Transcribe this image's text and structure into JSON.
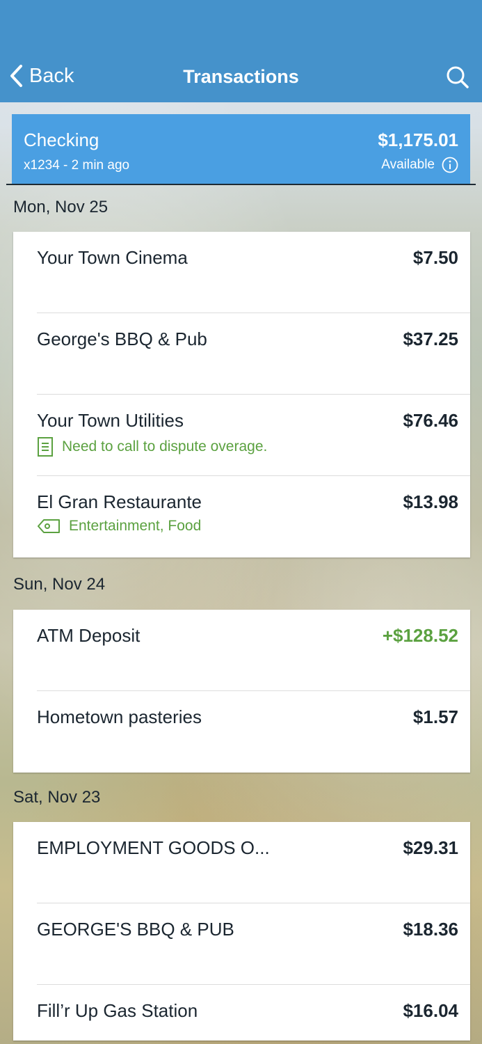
{
  "header": {
    "back_label": "Back",
    "title": "Transactions"
  },
  "account": {
    "name": "Checking",
    "subtitle": "x1234 - 2 min ago",
    "balance": "$1,175.01",
    "available_label": "Available"
  },
  "groups": [
    {
      "date": "Mon, Nov 25",
      "transactions": [
        {
          "name": "Your Town Cinema",
          "amount": "$7.50"
        },
        {
          "name": "George's BBQ & Pub",
          "amount": "$37.25"
        },
        {
          "name": "Your Town Utilities",
          "amount": "$76.46",
          "note": "Need to call to dispute overage."
        },
        {
          "name": "El Gran Restaurante",
          "amount": "$13.98",
          "tags": "Entertainment, Food"
        }
      ]
    },
    {
      "date": "Sun, Nov 24",
      "transactions": [
        {
          "name": "ATM Deposit",
          "amount": "+$128.52"
        },
        {
          "name": "Hometown pasteries",
          "amount": "$1.57"
        }
      ]
    },
    {
      "date": "Sat, Nov 23",
      "transactions": [
        {
          "name": "EMPLOYMENT GOODS O...",
          "amount": "$29.31"
        },
        {
          "name": "GEORGE'S BBQ & PUB",
          "amount": "$18.36"
        },
        {
          "name": "Fill’r Up Gas Station",
          "amount": "$16.04"
        }
      ]
    }
  ],
  "colors": {
    "header": "#4592cb",
    "account_card": "#4a9fe2",
    "positive": "#5ba140"
  },
  "icons": {
    "back": "chevron-left-icon",
    "search": "search-icon",
    "info": "info-icon",
    "note": "note-icon",
    "tag": "tag-icon"
  }
}
